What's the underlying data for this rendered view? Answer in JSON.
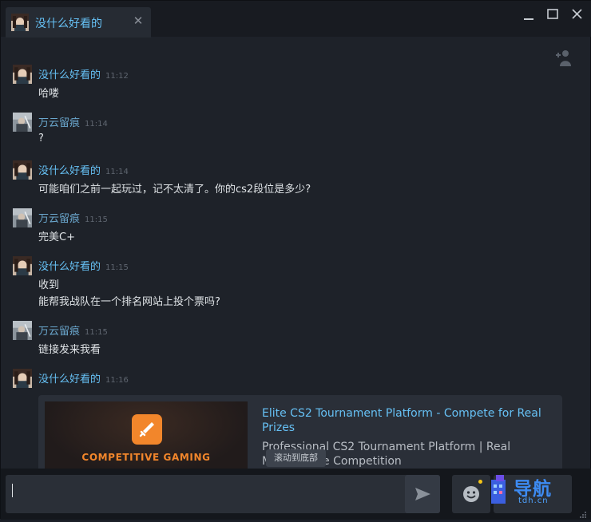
{
  "window": {
    "tab_title": "没什么好看的",
    "controls": [
      "minimize-icon",
      "maximize-icon",
      "close-icon"
    ]
  },
  "messages": [
    {
      "sender": "没什么好看的",
      "time": "11:12",
      "lines": [
        "哈喽"
      ],
      "self": true
    },
    {
      "sender": "万云留痕",
      "time": "11:14",
      "lines": [
        "?"
      ],
      "self": false
    },
    {
      "sender": "没什么好看的",
      "time": "11:14",
      "lines": [
        "可能咱们之前一起玩过，记不太清了。你的cs2段位是多少?"
      ],
      "self": true
    },
    {
      "sender": "万云留痕",
      "time": "11:15",
      "lines": [
        "完美C+"
      ],
      "self": false
    },
    {
      "sender": "没什么好看的",
      "time": "11:15",
      "lines": [
        "收到",
        "能帮我战队在一个排名网站上投个票吗?"
      ],
      "self": true
    },
    {
      "sender": "万云留痕",
      "time": "11:15",
      "lines": [
        "链接发来我看"
      ],
      "self": false
    },
    {
      "sender": "没什么好看的",
      "time": "11:16",
      "lines": [],
      "self": true
    }
  ],
  "link_card": {
    "image_text": "COMPETITIVE GAMING",
    "title": "Elite CS2 Tournament Platform - Compete for Real Prizes",
    "description": "Professional CS2 Tournament Platform | Real Money Prize Competition"
  },
  "scroll_tip": "滚动到底部",
  "input": {
    "value": ""
  },
  "watermark": {
    "text": "导航",
    "sub": "tdh.cn"
  },
  "colors": {
    "accent": "#66c0f4",
    "card_orange": "#f2862b",
    "background": "#1e2229"
  }
}
